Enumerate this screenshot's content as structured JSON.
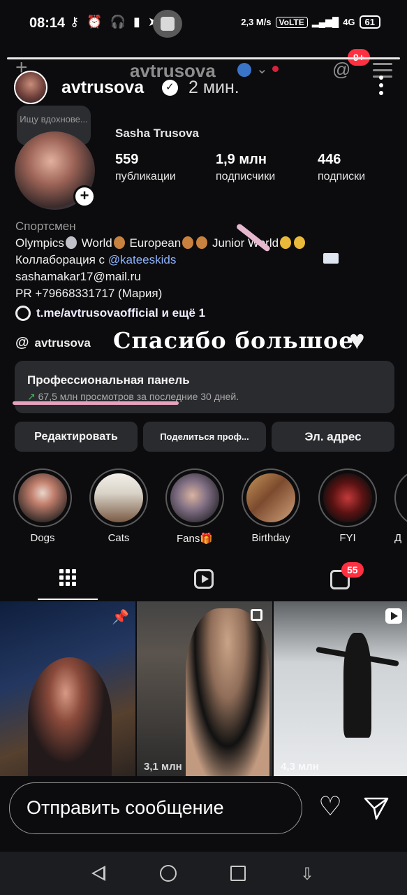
{
  "status_bar": {
    "time": "08:14",
    "speed": "2,3 M/s",
    "volte": "VoLTE",
    "network": "4G",
    "battery": "61"
  },
  "profile_header": {
    "username": "avtrusova",
    "notifications_badge": "9+"
  },
  "story": {
    "username": "avtrusova",
    "time_ago": "2 мин."
  },
  "profile": {
    "note": "Ищу вдохнове...",
    "display_name": "Sasha Trusova",
    "stats": [
      {
        "value": "559",
        "label": "публикации"
      },
      {
        "value": "1,9 млн",
        "label": "подписчики"
      },
      {
        "value": "446",
        "label": "подписки"
      }
    ],
    "category": "Спортсмен",
    "bio_line1_a": "Olympics",
    "bio_line1_b": "World",
    "bio_line1_c": "European",
    "bio_line1_d": "Junior World",
    "bio_collab_prefix": "Коллаборация с ",
    "bio_collab_mention": "@kateeskids",
    "bio_email": "sashamakar17@mail.ru",
    "bio_pr": "PR +79668331717 (Мария)",
    "link": "t.me/avtrusovaofficial и ещё 1",
    "threads_handle": "avtrusova"
  },
  "sticker": {
    "text": "Спасибо большое"
  },
  "pro_panel": {
    "title": "Профессиональная панель",
    "views": "67,5 млн просмотров",
    "period": " за последние 30 дней."
  },
  "buttons": {
    "edit": "Редактировать",
    "share": "Поделиться проф...",
    "email": "Эл. адрес"
  },
  "highlights": [
    {
      "label": "Dogs"
    },
    {
      "label": "Cats"
    },
    {
      "label": "Fans🎁"
    },
    {
      "label": "Birthday"
    },
    {
      "label": "FYI"
    },
    {
      "label": "Д"
    }
  ],
  "tabs": {
    "tagged_badge": "55"
  },
  "posts": [
    {
      "views": ""
    },
    {
      "views": "3,1 млн"
    },
    {
      "views": "4,3 млн"
    }
  ],
  "reply": {
    "placeholder": "Отправить сообщение"
  },
  "colors": {
    "accent_badge": "#ff3040",
    "verified": "#3a74c9",
    "mention": "#8db3ff",
    "highlight_underline": "#e7a2bd"
  }
}
